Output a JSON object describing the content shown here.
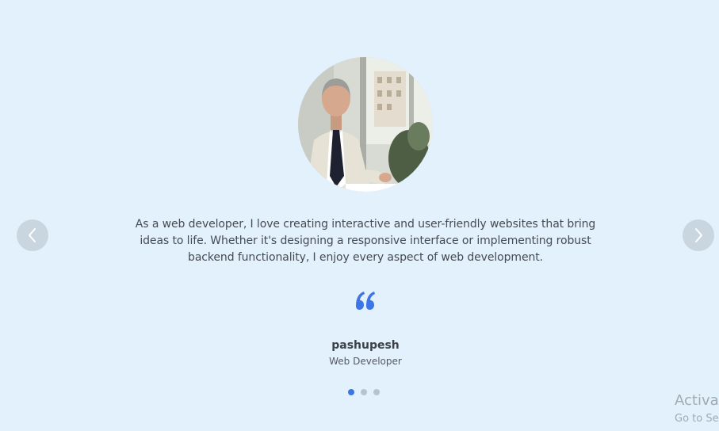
{
  "testimonial": {
    "text": "As a web developer, I love creating interactive and user-friendly websites that bring ideas to life. Whether it's designing a responsive interface or implementing robust backend functionality, I enjoy every aspect of web development.",
    "name": "pashupesh",
    "role": "Web Developer",
    "quote_icon": "quote-icon",
    "accent_color": "#3d74e6"
  },
  "navigation": {
    "prev_icon": "chevron-left-icon",
    "next_icon": "chevron-right-icon"
  },
  "pagination": {
    "count": 3,
    "active_index": 0
  },
  "watermark": {
    "title": "Activat",
    "subtitle": "Go to Se"
  }
}
